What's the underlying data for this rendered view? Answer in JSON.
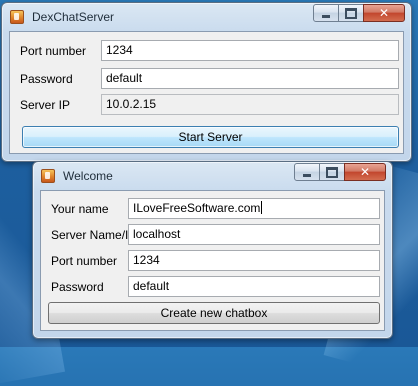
{
  "server_window": {
    "title": "DexChatServer",
    "fields": [
      {
        "label": "Port number",
        "value": "1234"
      },
      {
        "label": "Password",
        "value": "default"
      },
      {
        "label": "Server IP",
        "value": "10.0.2.15"
      }
    ],
    "start_button": "Start Server"
  },
  "welcome_window": {
    "title": "Welcome",
    "fields": [
      {
        "label": "Your name",
        "value": "ILoveFreeSoftware.com"
      },
      {
        "label": "Server Name/IP",
        "value": "localhost"
      },
      {
        "label": "Port number",
        "value": "1234"
      },
      {
        "label": "Password",
        "value": "default"
      }
    ],
    "create_button": "Create new chatbox"
  },
  "window_controls": {
    "minimize_icon": "minimize-icon",
    "maximize_icon": "maximize-icon",
    "close_glyph": "✕"
  },
  "colors": {
    "desktop": "#1d5f9f",
    "client_bg": "#f0f0f0",
    "close_button": "#c2462d",
    "focused_button_border": "#3c7fb1"
  }
}
